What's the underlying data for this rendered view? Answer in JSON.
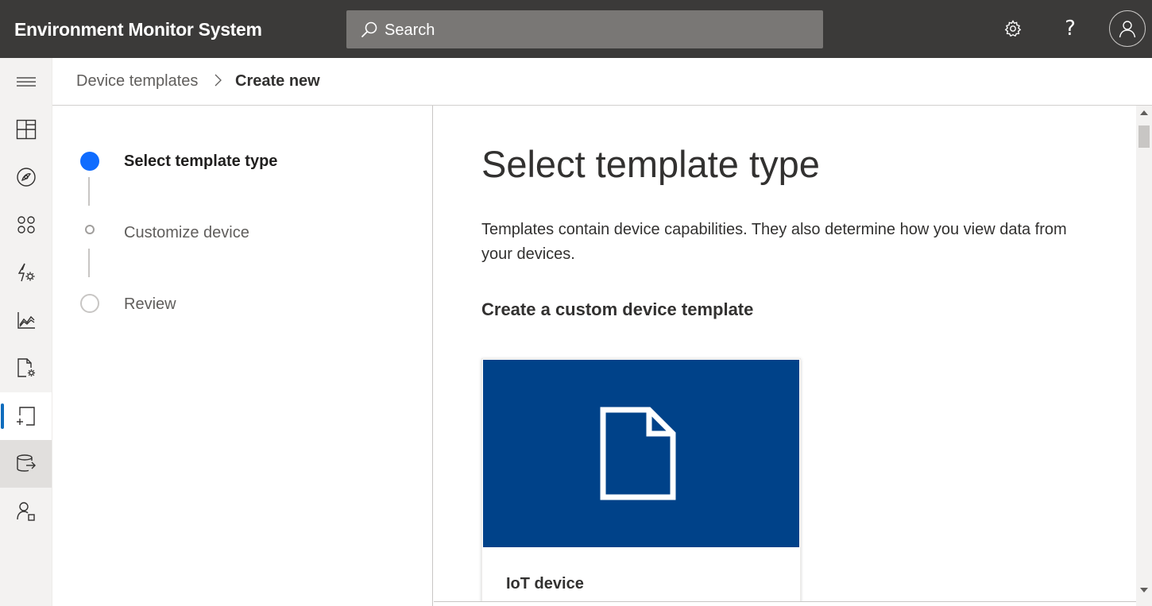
{
  "app": {
    "title": "Environment Monitor System"
  },
  "search": {
    "placeholder": "Search"
  },
  "header_icons": [
    "gear-icon",
    "help-icon",
    "user-avatar-icon"
  ],
  "help_glyph": "?",
  "nav": {
    "items": [
      {
        "icon": "hamburger-menu-icon"
      },
      {
        "icon": "dashboard-icon"
      },
      {
        "icon": "devices-icon"
      },
      {
        "icon": "device-groups-icon"
      },
      {
        "icon": "rules-icon"
      },
      {
        "icon": "analytics-icon"
      },
      {
        "icon": "jobs-icon"
      },
      {
        "icon": "device-templates-icon",
        "selected": true
      },
      {
        "icon": "data-export-icon"
      },
      {
        "icon": "administration-icon"
      }
    ]
  },
  "breadcrumb": {
    "parent": "Device templates",
    "current": "Create new"
  },
  "steps": [
    {
      "label": "Select template type",
      "state": "active"
    },
    {
      "label": "Customize device",
      "state": "pending"
    },
    {
      "label": "Review",
      "state": "pending"
    }
  ],
  "main": {
    "title": "Select template type",
    "description": "Templates contain device capabilities. They also determine how you view data from your devices.",
    "section_title": "Create a custom device template",
    "card": {
      "label": "IoT device",
      "icon": "file-icon"
    }
  },
  "colors": {
    "topbar": "#3b3a39",
    "accent": "#0f6cff",
    "card_banner": "#004289"
  }
}
